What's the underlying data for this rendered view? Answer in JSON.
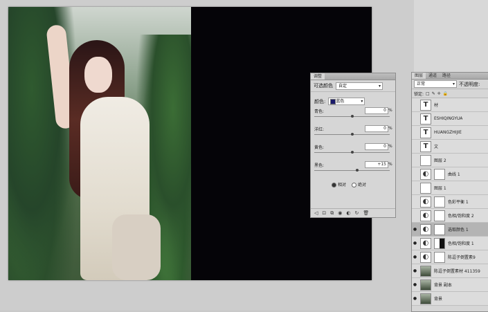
{
  "adjustments_panel": {
    "tab": "调整",
    "preset_label": "可选颜色",
    "preset_value": "自定",
    "color_label": "颜色:",
    "color_value": "蓝色",
    "sliders": [
      {
        "label": "青色:",
        "value": "0",
        "unit": "%",
        "level": 0.5
      },
      {
        "label": "洋红:",
        "value": "0",
        "unit": "%",
        "level": 0.5
      },
      {
        "label": "黄色:",
        "value": "0",
        "unit": "%",
        "level": 0.5
      },
      {
        "label": "黑色:",
        "value": "+15",
        "unit": "%",
        "level": 0.57
      }
    ],
    "method_relative": "相对",
    "method_absolute": "绝对"
  },
  "layers_panel": {
    "tabs": [
      "图层",
      "通道",
      "路径"
    ],
    "blend_mode": "正常",
    "opacity_label": "不透明度:",
    "lock_label": "锁定:",
    "layers": [
      {
        "name": "材",
        "thumb": "text",
        "mask": false,
        "selected": false,
        "visible": false
      },
      {
        "name": "ESHIQINGYUA",
        "thumb": "text",
        "mask": false,
        "selected": false,
        "visible": false
      },
      {
        "name": "HUANGZHIJIE",
        "thumb": "text",
        "mask": false,
        "selected": false,
        "visible": false
      },
      {
        "name": "文",
        "thumb": "text",
        "mask": false,
        "selected": false,
        "visible": false
      },
      {
        "name": "图层 2",
        "thumb": "blank",
        "mask": false,
        "selected": false,
        "visible": false
      },
      {
        "name": "曲线 1",
        "thumb": "adjust",
        "mask": true,
        "selected": false,
        "visible": false
      },
      {
        "name": "图层 1",
        "thumb": "blank",
        "mask": false,
        "selected": false,
        "visible": false
      },
      {
        "name": "色彩平衡 1",
        "thumb": "adjust",
        "mask": true,
        "selected": false,
        "visible": false
      },
      {
        "name": "色相/饱和度 2",
        "thumb": "adjust",
        "mask": true,
        "selected": false,
        "visible": false
      },
      {
        "name": "选取颜色 1",
        "thumb": "adjust",
        "mask": true,
        "selected": true,
        "visible": true
      },
      {
        "name": "色相/饱和度 1",
        "thumb": "adjust",
        "mask": "half",
        "selected": false,
        "visible": true
      },
      {
        "name": "陈逗子倒置素9",
        "thumb": "adjust",
        "mask": true,
        "selected": false,
        "visible": true
      },
      {
        "name": "陈逗子倒置素材 411359",
        "thumb": "photo",
        "mask": false,
        "selected": false,
        "visible": true
      },
      {
        "name": "背景 副本",
        "thumb": "photo",
        "mask": false,
        "selected": false,
        "visible": true
      },
      {
        "name": "背景",
        "thumb": "photo",
        "mask": false,
        "selected": false,
        "visible": true
      }
    ]
  },
  "icons": [
    "eye-icon",
    "link-icon",
    "adjustment-icon",
    "trash-icon",
    "refresh-icon"
  ]
}
